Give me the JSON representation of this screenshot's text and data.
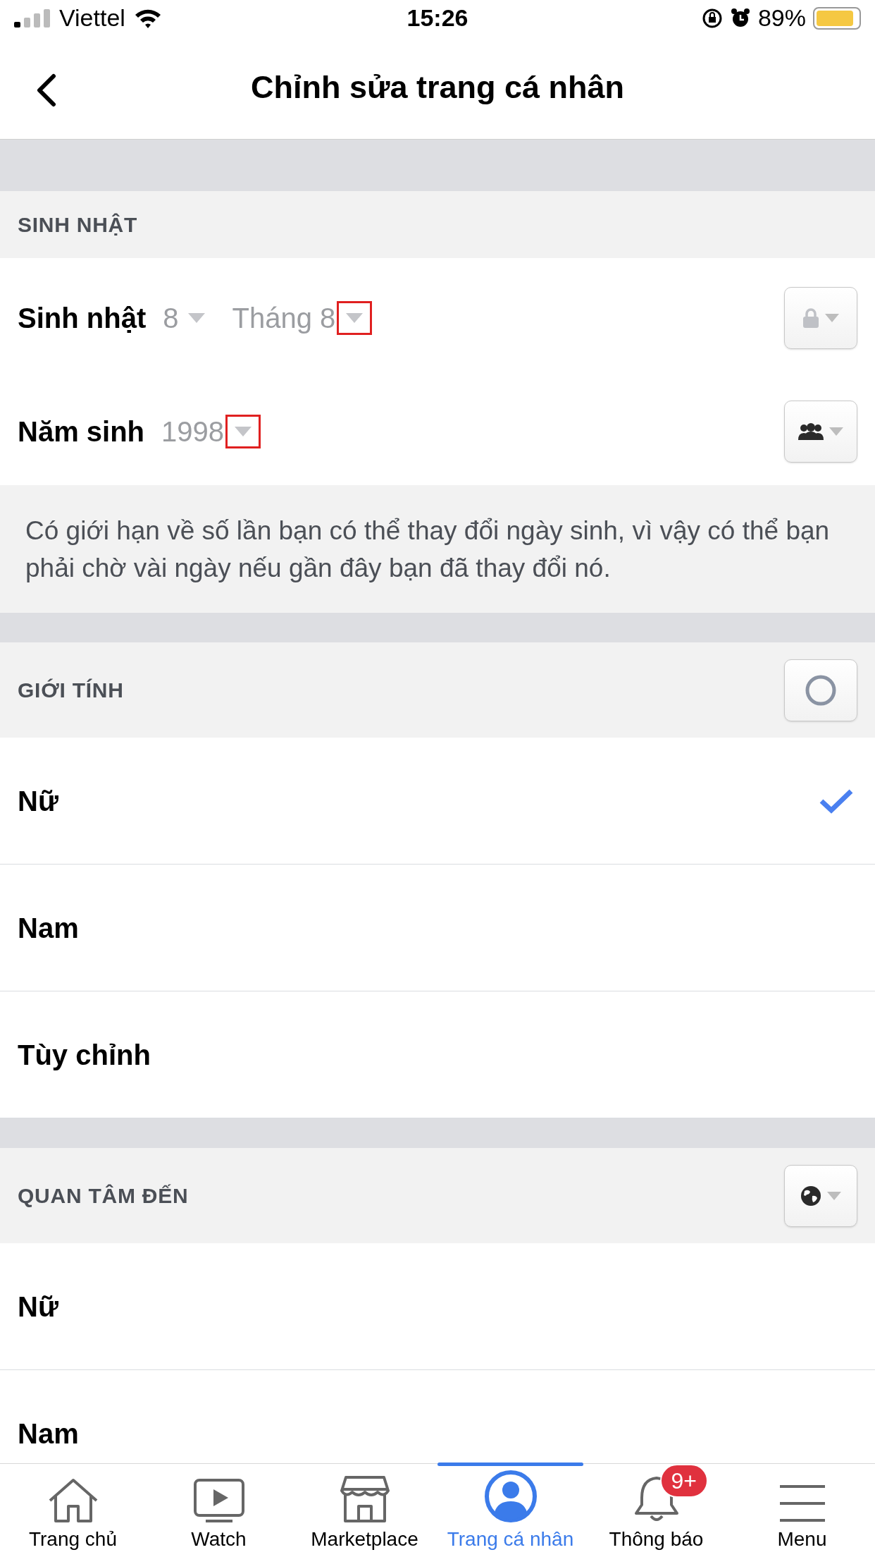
{
  "status_bar": {
    "carrier": "Viettel",
    "time": "15:26",
    "battery": "89%"
  },
  "header": {
    "title": "Chỉnh sửa trang cá nhân"
  },
  "birthday_section": {
    "title": "SINH NHẬT",
    "rows": [
      {
        "label": "Sinh nhật",
        "fields": [
          {
            "value": "8",
            "highlighted": false
          },
          {
            "value": "Tháng 8",
            "highlighted": true
          }
        ],
        "privacy": {
          "kind": "lock"
        }
      },
      {
        "label": "Năm sinh",
        "fields": [
          {
            "value": "1998",
            "highlighted": true
          }
        ],
        "privacy": {
          "kind": "friends"
        }
      }
    ],
    "note": "Có giới hạn về số lần bạn có thể thay đổi ngày sinh, vì vậy có thể bạn phải chờ vài ngày nếu gần đây bạn đã thay đổi nó."
  },
  "gender_section": {
    "title": "GIỚI TÍNH",
    "privacy": {
      "kind": "circle"
    },
    "options": [
      {
        "label": "Nữ",
        "selected": true
      },
      {
        "label": "Nam",
        "selected": false
      },
      {
        "label": "Tùy chỉnh",
        "selected": false
      }
    ]
  },
  "interested_in_section": {
    "title": "QUAN TÂM ĐẾN",
    "privacy": {
      "kind": "globe"
    },
    "options": [
      {
        "label": "Nữ",
        "selected": false
      },
      {
        "label": "Nam",
        "selected": false
      }
    ]
  },
  "tab_bar": [
    {
      "label": "Trang chủ",
      "kind": "home",
      "selected": false
    },
    {
      "label": "Watch",
      "kind": "watch",
      "selected": false
    },
    {
      "label": "Marketplace",
      "kind": "shop",
      "selected": false
    },
    {
      "label": "Trang cá nhân",
      "kind": "profile",
      "selected": true
    },
    {
      "label": "Thông báo",
      "kind": "bell",
      "selected": false,
      "badge": "9+"
    },
    {
      "label": "Menu",
      "kind": "menu",
      "selected": false
    }
  ]
}
